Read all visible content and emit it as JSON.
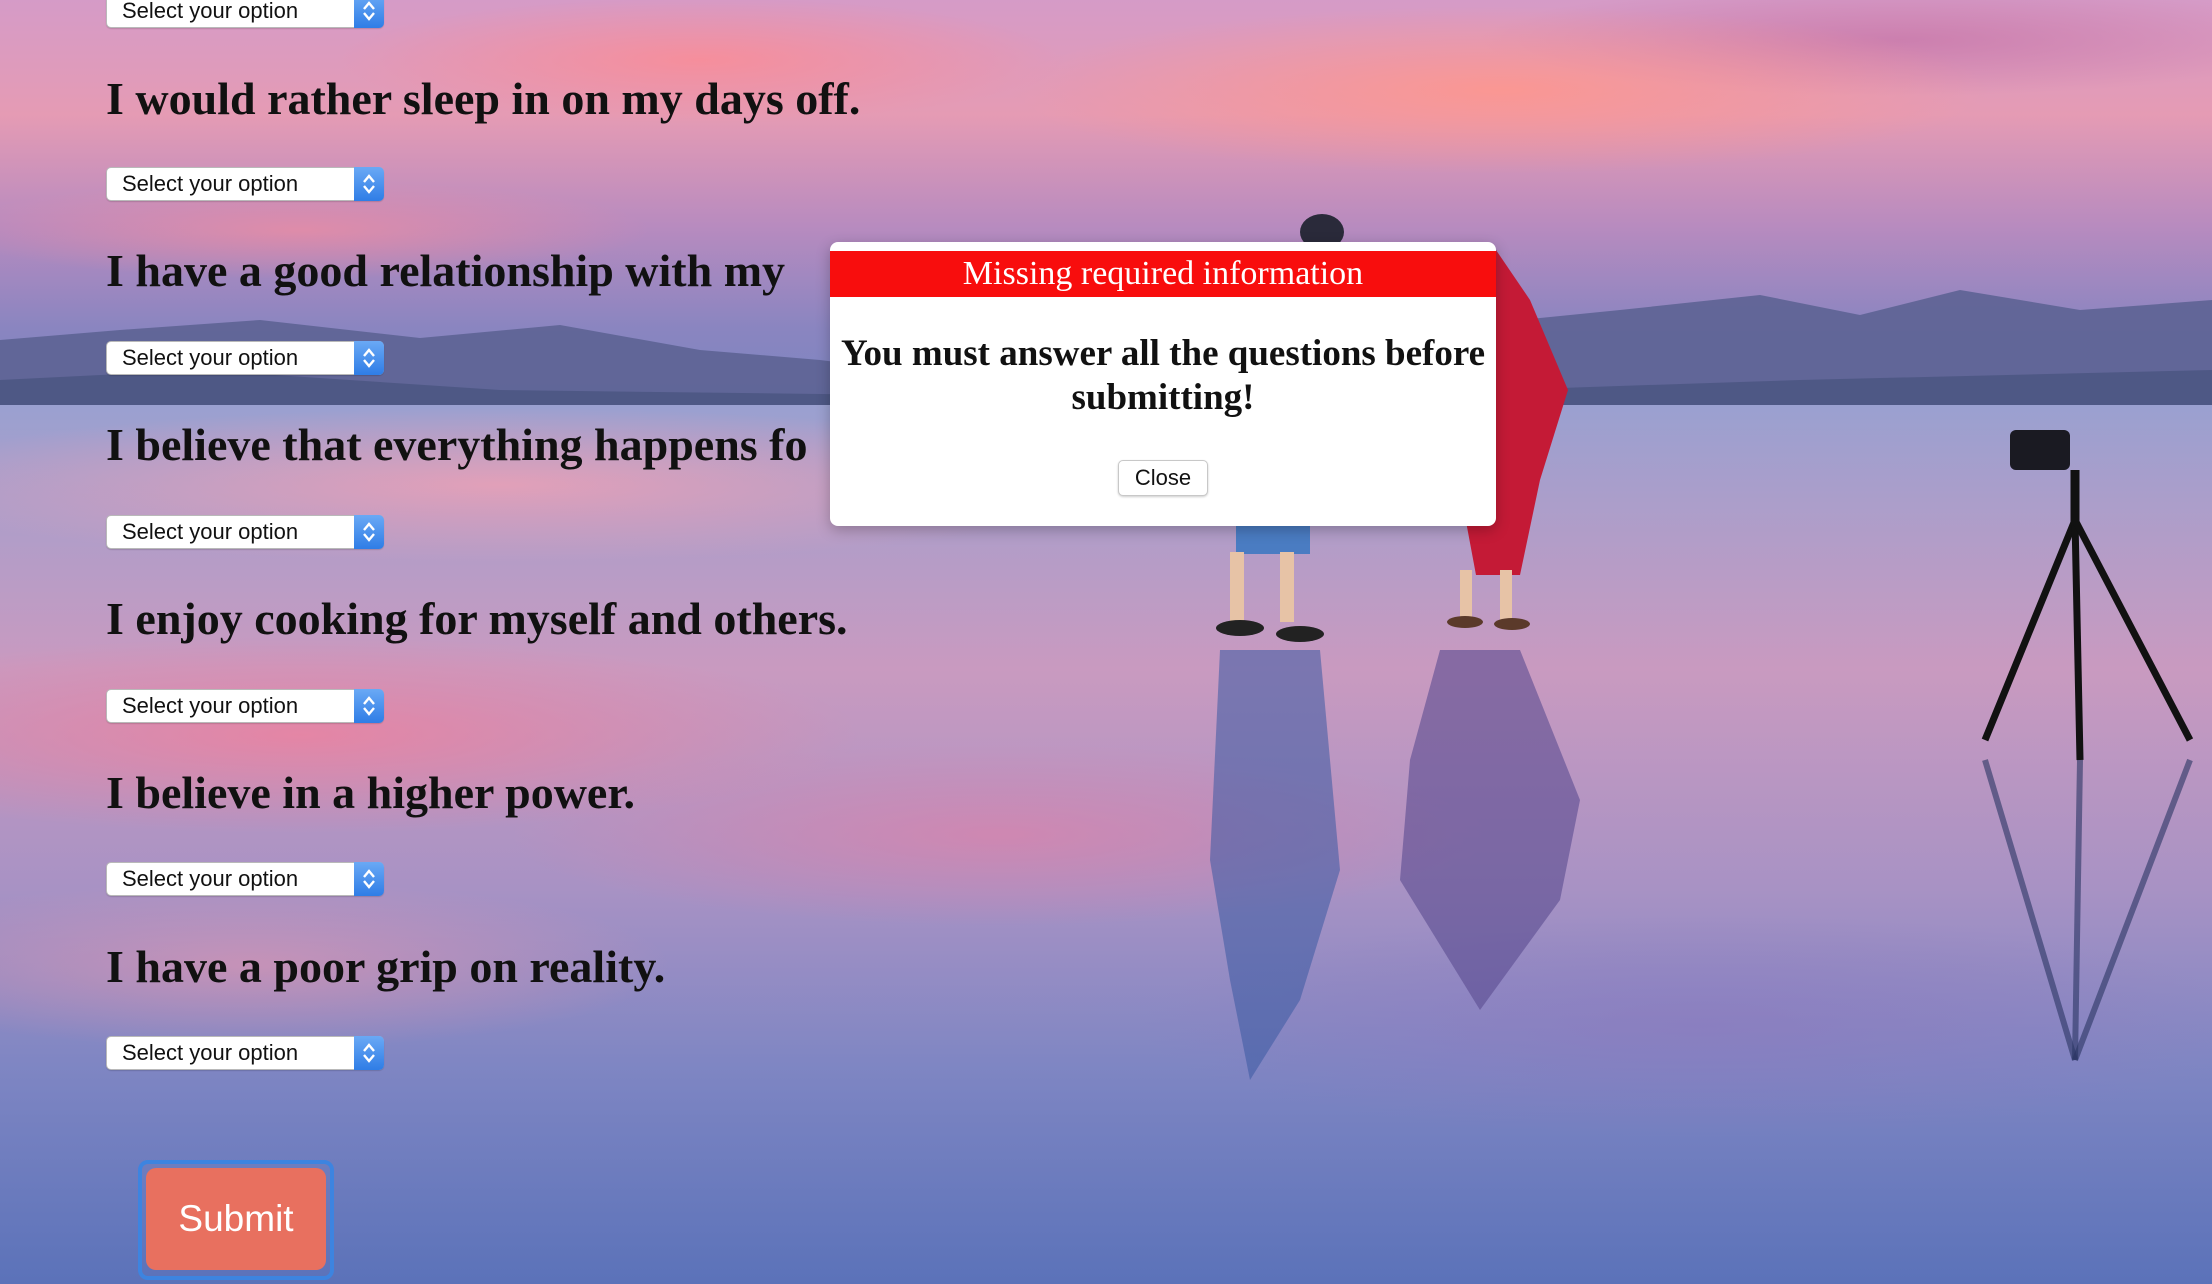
{
  "questions": [
    {
      "text": "",
      "select_value": "Select your option"
    },
    {
      "text": "I would rather sleep in on my days off.",
      "select_value": "Select your option"
    },
    {
      "text": "I have a good relationship with my",
      "select_value": "Select your option"
    },
    {
      "text": "I believe that everything happens fo",
      "select_value": "Select your option"
    },
    {
      "text": "I enjoy cooking for myself and others.",
      "select_value": "Select your option"
    },
    {
      "text": "I believe in a higher power.",
      "select_value": "Select your option"
    },
    {
      "text": "I have a poor grip on reality.",
      "select_value": "Select your option"
    }
  ],
  "submit_label": "Submit",
  "modal": {
    "title": "Missing required information",
    "message_line1": "You must answer all the questions before",
    "message_line2": "submitting!",
    "close_label": "Close"
  },
  "colors": {
    "modal_header": "#f80d0d",
    "submit_button": "#e8705f",
    "submit_focus_ring": "#3d84e0",
    "select_arrow": "#2f7de6"
  },
  "icons": {
    "select_arrow": "chevron-up-down-icon"
  }
}
